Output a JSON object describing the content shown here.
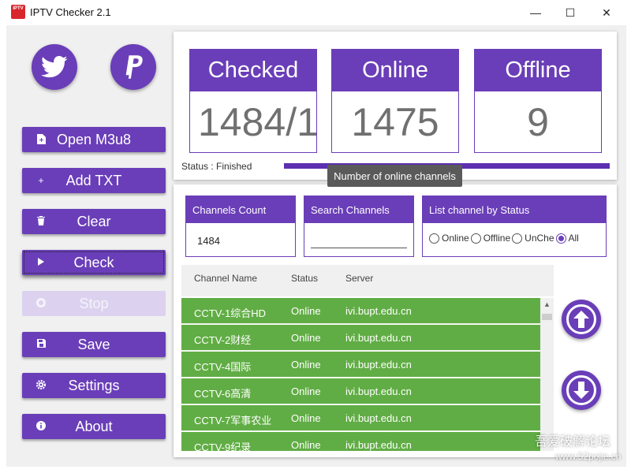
{
  "window": {
    "app_icon_text": "IPTV",
    "title": "IPTV Checker 2.1",
    "minimize_glyph": "—",
    "maximize_glyph": "☐",
    "close_glyph": "✕"
  },
  "social": [
    {
      "name": "twitter-icon"
    },
    {
      "name": "paypal-icon"
    }
  ],
  "sidebar": {
    "buttons": [
      {
        "label": "Open M3u8",
        "icon": "file-icon"
      },
      {
        "label": "Add TXT",
        "icon": "plus-icon"
      },
      {
        "label": "Clear",
        "icon": "trash-icon"
      },
      {
        "label": "Check",
        "icon": "play-icon"
      },
      {
        "label": "Stop",
        "icon": "stop-icon"
      },
      {
        "label": "Save",
        "icon": "save-icon"
      },
      {
        "label": "Settings",
        "icon": "gear-icon"
      },
      {
        "label": "About",
        "icon": "info-icon"
      }
    ]
  },
  "stats": {
    "checked_label": "Checked",
    "checked_value": "1484/1",
    "online_label": "Online",
    "online_value": "1475",
    "offline_label": "Offline",
    "offline_value": "9",
    "status_text": "Status : Finished",
    "progress_fraction": 1.0,
    "tooltip": "Number of online channels"
  },
  "filters": {
    "count_label": "Channels Count",
    "count_value": "1484",
    "search_label": "Search Channels",
    "search_value": "",
    "status_label": "List channel by Status",
    "status_options": [
      "Online",
      "Offline",
      "UnChe",
      "All"
    ],
    "status_selected": "All"
  },
  "table": {
    "headers": [
      "Channel Name",
      "Status",
      "Server"
    ],
    "rows": [
      [
        "CCTV-1综合HD",
        "Online",
        "ivi.bupt.edu.cn"
      ],
      [
        "CCTV-2财经",
        "Online",
        "ivi.bupt.edu.cn"
      ],
      [
        "CCTV-4国际",
        "Online",
        "ivi.bupt.edu.cn"
      ],
      [
        "CCTV-6高清",
        "Online",
        "ivi.bupt.edu.cn"
      ],
      [
        "CCTV-7军事农业",
        "Online",
        "ivi.bupt.edu.cn"
      ],
      [
        "CCTV-9纪录",
        "Online",
        "ivi.bupt.edu.cn"
      ]
    ]
  },
  "colors": {
    "accent": "#6a3eb8",
    "online_row": "#61ad45"
  },
  "watermark": {
    "line1": "吾爱破解论坛",
    "line2": "www.52pojie.cn"
  }
}
